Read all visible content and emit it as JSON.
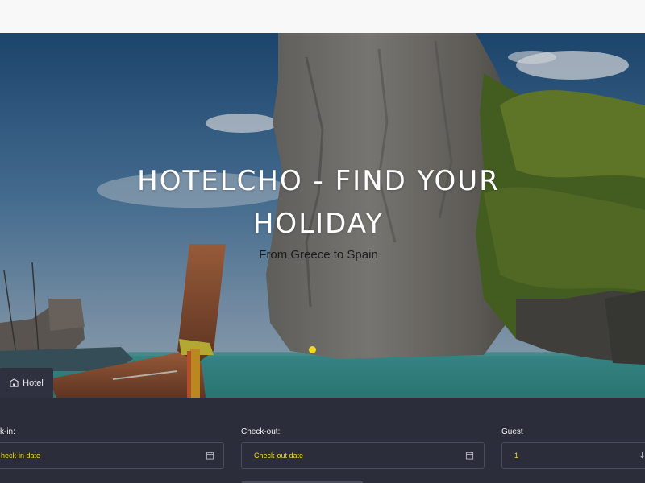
{
  "hero": {
    "title": "HOTELCHO - FIND YOUR HOLIDAY",
    "subtitle": "From Greece to Spain",
    "slide_indicator_color": "#f5d820"
  },
  "tabs": [
    {
      "label": "Hotel",
      "icon": "hotel-icon",
      "active": true
    }
  ],
  "booking_form": {
    "checkin": {
      "label": "k-in:",
      "value": "heck-in date",
      "icon": "calendar-icon"
    },
    "checkout": {
      "label": "Check-out:",
      "value": "Check-out date",
      "icon": "calendar-icon"
    },
    "guest": {
      "label": "Guest",
      "value": "1",
      "icon": "chevron-down-icon"
    }
  },
  "colors": {
    "accent": "#f5d820",
    "panel": "#2b2d3b",
    "topbar": "#f8f8f9"
  }
}
